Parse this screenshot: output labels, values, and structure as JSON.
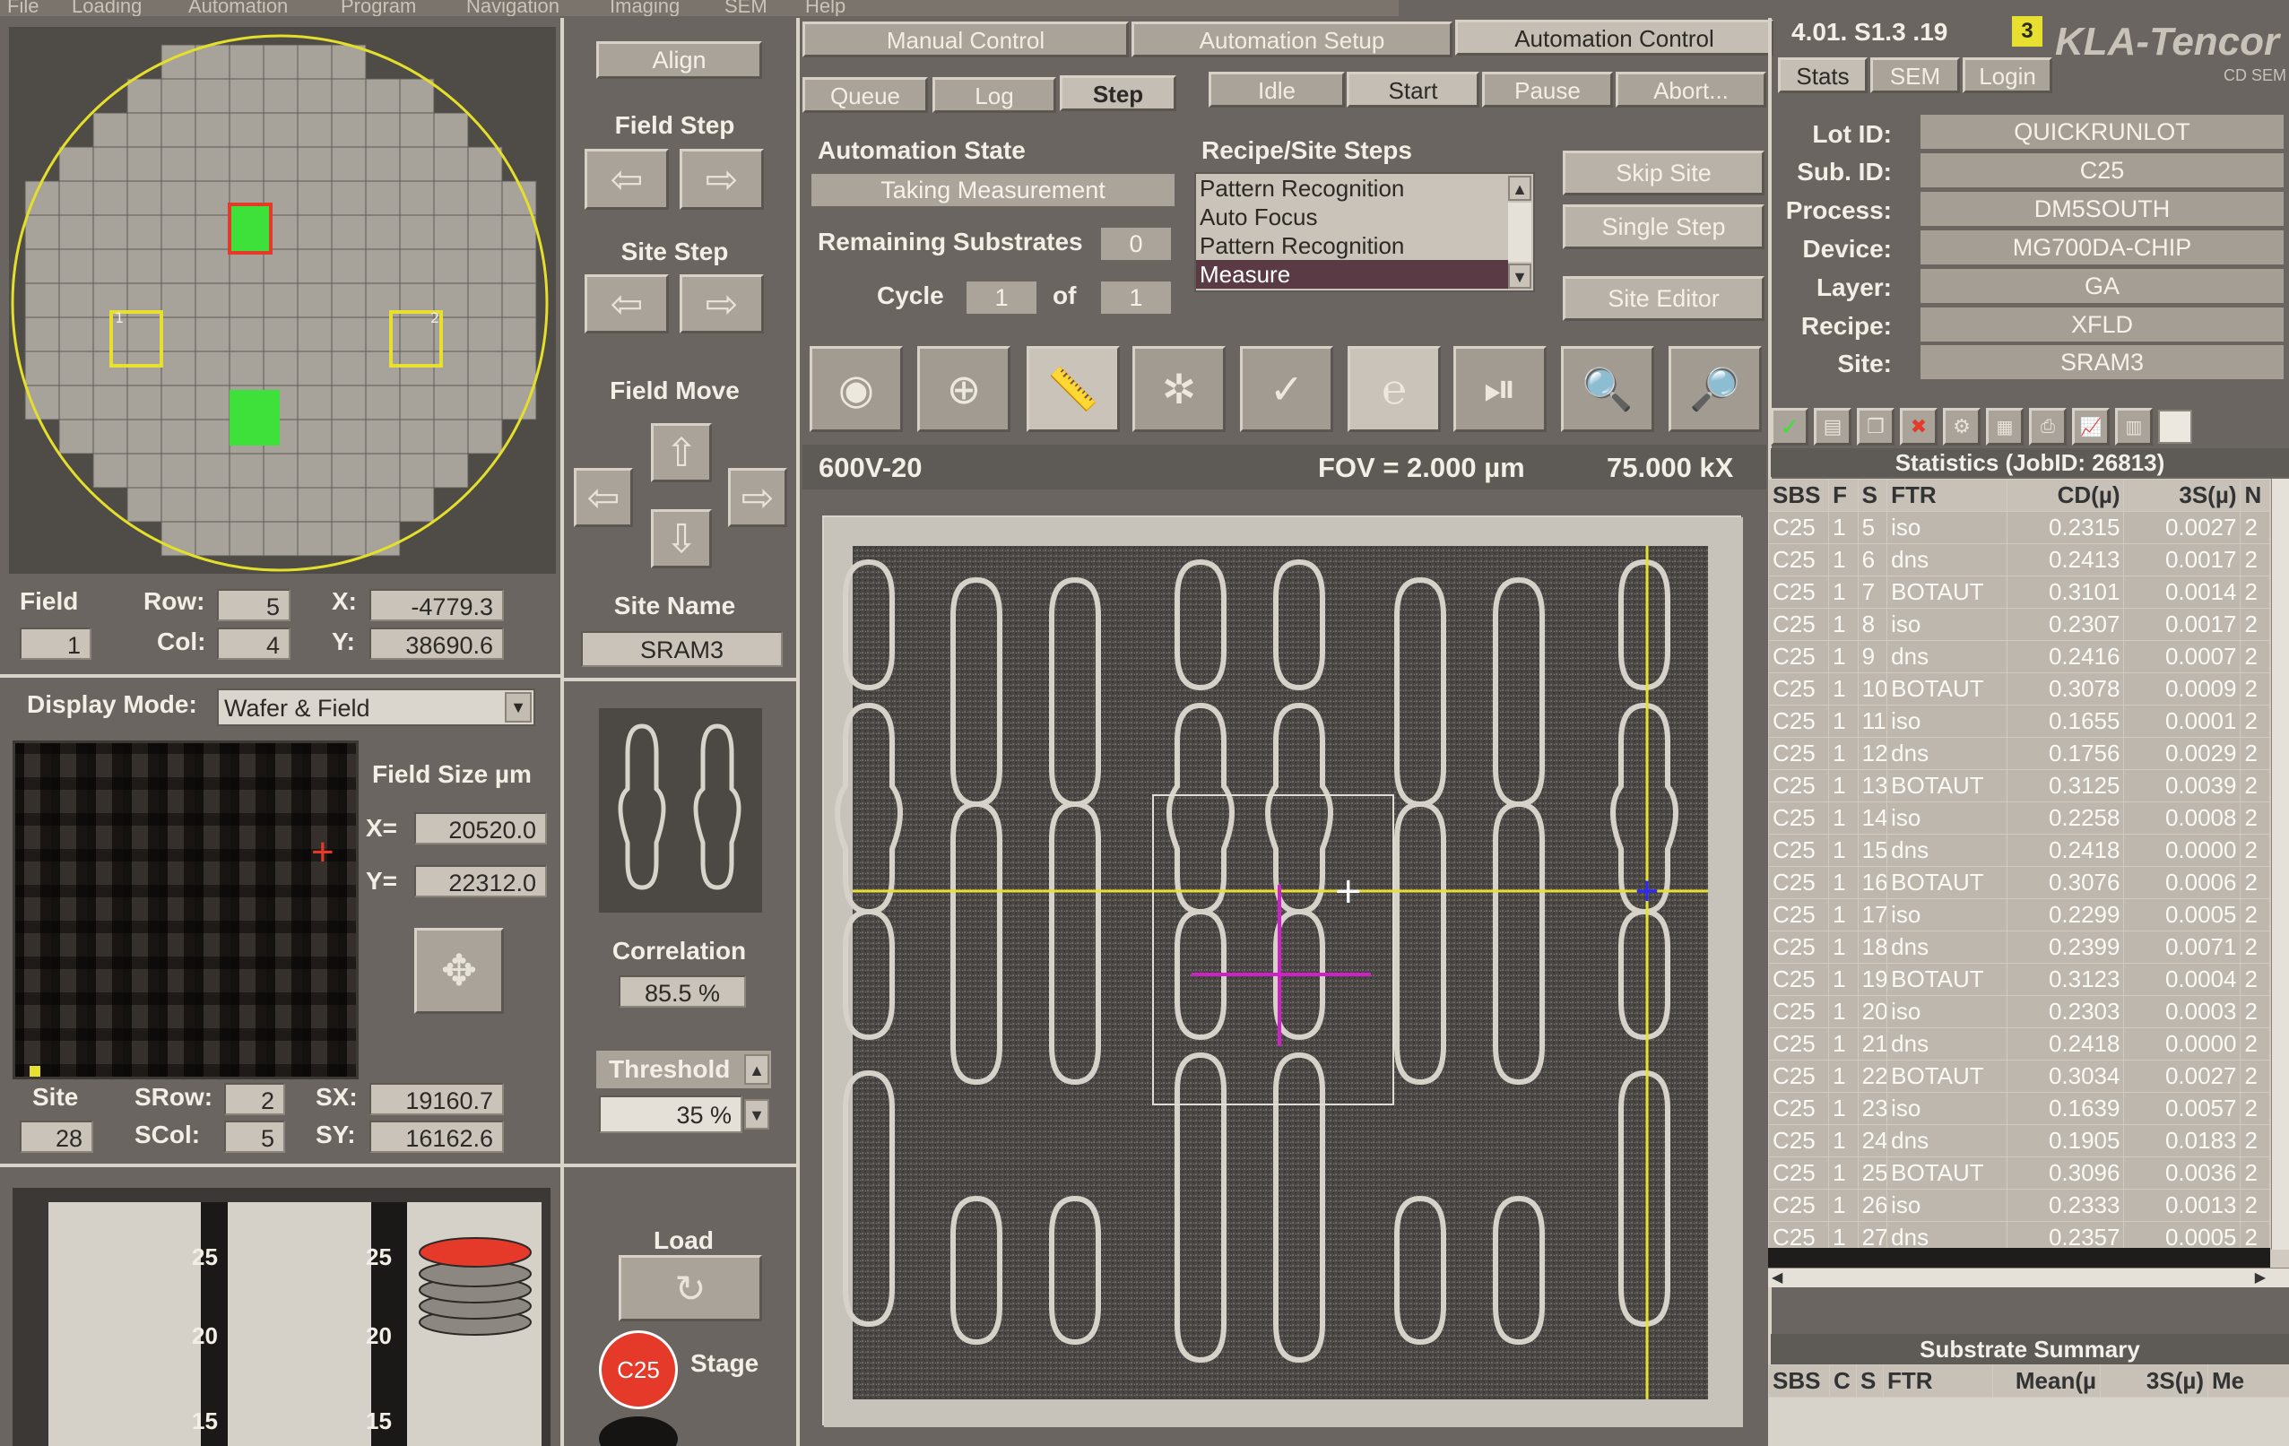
{
  "menu": [
    "File",
    "Loading",
    "Automation",
    "Program",
    "Navigation",
    "Imaging",
    "SEM",
    "Help"
  ],
  "wafer_panel": {
    "field_label": "Field",
    "field_value": "1",
    "row_label": "Row:",
    "row_value": "5",
    "col_label": "Col:",
    "col_value": "4",
    "x_label": "X:",
    "x_value": "-4779.3",
    "y_label": "Y:",
    "y_value": "38690.6",
    "site_markers": [
      "1",
      "2"
    ]
  },
  "display": {
    "mode_label": "Display Mode:",
    "mode_value": "Wafer & Field",
    "field_size_label": "Field Size µm",
    "x_label": "X=",
    "x_value": "20520.0",
    "y_label": "Y=",
    "y_value": "22312.0",
    "site_label": "Site",
    "site_value": "28",
    "srow_label": "SRow:",
    "srow_value": "2",
    "scol_label": "SCol:",
    "scol_value": "5",
    "sx_label": "SX:",
    "sx_value": "19160.7",
    "sy_label": "SY:",
    "sy_value": "16162.6"
  },
  "cassette": {
    "labels": [
      "25",
      "20",
      "15"
    ]
  },
  "nav": {
    "align": "Align",
    "field_step": "Field Step",
    "site_step": "Site Step",
    "field_move": "Field Move",
    "site_name_label": "Site Name",
    "site_name": "SRAM3",
    "correlation_label": "Correlation",
    "correlation_value": "85.5 %",
    "threshold_label": "Threshold",
    "threshold_value": "35 %",
    "load_label": "Load",
    "stage_badge": "C25",
    "stage_label": "Stage"
  },
  "tabs_top": [
    "Manual Control",
    "Automation Setup",
    "Automation Control"
  ],
  "tabs_sub": [
    "Queue",
    "Log",
    "Step"
  ],
  "run_buttons": [
    "Idle",
    "Start",
    "Pause",
    "Abort..."
  ],
  "automation": {
    "state_label": "Automation State",
    "state_value": "Taking Measurement",
    "remaining_label": "Remaining Substrates",
    "remaining_value": "0",
    "cycle_label": "Cycle",
    "cycle_value": "1",
    "of_label": "of",
    "cycle_total": "1",
    "steps_label": "Recipe/Site Steps",
    "steps": [
      "Pattern Recognition",
      "Auto Focus",
      "Pattern Recognition",
      "Measure"
    ],
    "skip_site": "Skip Site",
    "single_step": "Single Step",
    "site_editor": "Site Editor"
  },
  "image": {
    "recipe": "600V-20",
    "fov": "FOV = 2.000 µm",
    "mag": "75.000 kX"
  },
  "header_right": {
    "version": "4.01. S1.3 .19",
    "badge": "3",
    "logo": "KLA-Tencor",
    "logo_sub": "CD SEM",
    "tabs": [
      "Stats",
      "SEM",
      "Login"
    ]
  },
  "lot_info": [
    {
      "label": "Lot ID:",
      "value": "QUICKRUNLOT"
    },
    {
      "label": "Sub. ID:",
      "value": "C25"
    },
    {
      "label": "Process:",
      "value": "DM5SOUTH"
    },
    {
      "label": "Device:",
      "value": "MG700DA-CHIP"
    },
    {
      "label": "Layer:",
      "value": "GA"
    },
    {
      "label": "Recipe:",
      "value": "XFLD"
    },
    {
      "label": "Site:",
      "value": "SRAM3"
    }
  ],
  "statistics": {
    "title": "Statistics (JobID: 26813)",
    "headers": [
      "SBS",
      "F",
      "S",
      "FTR",
      "CD(µ)",
      "3S(µ)",
      "N"
    ],
    "rows": [
      [
        "C25",
        "1",
        "5",
        "iso",
        "0.2315",
        "0.0027",
        "2"
      ],
      [
        "C25",
        "1",
        "6",
        "dns",
        "0.2413",
        "0.0017",
        "2"
      ],
      [
        "C25",
        "1",
        "7",
        "BOTAUT",
        "0.3101",
        "0.0014",
        "2"
      ],
      [
        "C25",
        "1",
        "8",
        "iso",
        "0.2307",
        "0.0017",
        "2"
      ],
      [
        "C25",
        "1",
        "9",
        "dns",
        "0.2416",
        "0.0007",
        "2"
      ],
      [
        "C25",
        "1",
        "10",
        "BOTAUT",
        "0.3078",
        "0.0009",
        "2"
      ],
      [
        "C25",
        "1",
        "11",
        "iso",
        "0.1655",
        "0.0001",
        "2"
      ],
      [
        "C25",
        "1",
        "12",
        "dns",
        "0.1756",
        "0.0029",
        "2"
      ],
      [
        "C25",
        "1",
        "13",
        "BOTAUT",
        "0.3125",
        "0.0039",
        "2"
      ],
      [
        "C25",
        "1",
        "14",
        "iso",
        "0.2258",
        "0.0008",
        "2"
      ],
      [
        "C25",
        "1",
        "15",
        "dns",
        "0.2418",
        "0.0000",
        "2"
      ],
      [
        "C25",
        "1",
        "16",
        "BOTAUT",
        "0.3076",
        "0.0006",
        "2"
      ],
      [
        "C25",
        "1",
        "17",
        "iso",
        "0.2299",
        "0.0005",
        "2"
      ],
      [
        "C25",
        "1",
        "18",
        "dns",
        "0.2399",
        "0.0071",
        "2"
      ],
      [
        "C25",
        "1",
        "19",
        "BOTAUT",
        "0.3123",
        "0.0004",
        "2"
      ],
      [
        "C25",
        "1",
        "20",
        "iso",
        "0.2303",
        "0.0003",
        "2"
      ],
      [
        "C25",
        "1",
        "21",
        "dns",
        "0.2418",
        "0.0000",
        "2"
      ],
      [
        "C25",
        "1",
        "22",
        "BOTAUT",
        "0.3034",
        "0.0027",
        "2"
      ],
      [
        "C25",
        "1",
        "23",
        "iso",
        "0.1639",
        "0.0057",
        "2"
      ],
      [
        "C25",
        "1",
        "24",
        "dns",
        "0.1905",
        "0.0183",
        "2"
      ],
      [
        "C25",
        "1",
        "25",
        "BOTAUT",
        "0.3096",
        "0.0036",
        "2"
      ],
      [
        "C25",
        "1",
        "26",
        "iso",
        "0.2333",
        "0.0013",
        "2"
      ],
      [
        "C25",
        "1",
        "27",
        "dns",
        "0.2357",
        "0.0005",
        "2"
      ]
    ]
  },
  "substrate_summary": {
    "title": "Substrate Summary",
    "headers": [
      "SBS",
      "C",
      "S",
      "FTR",
      "Mean(µ",
      "3S(µ)",
      "Me"
    ]
  },
  "colors": {
    "accent_green": "#3ee03a",
    "highlight_yellow": "#e8e030",
    "red": "#e53a2a",
    "magenta": "#d020c8"
  }
}
